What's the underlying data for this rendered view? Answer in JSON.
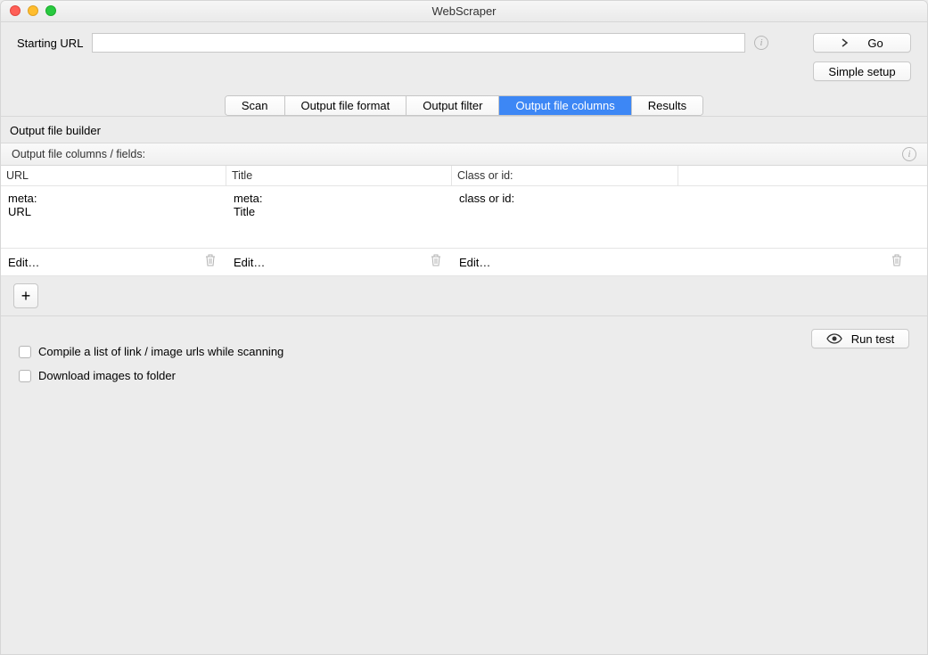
{
  "window": {
    "title": "WebScraper"
  },
  "url_bar": {
    "label": "Starting URL",
    "value": "",
    "go_label": "Go",
    "simple_setup_label": "Simple setup"
  },
  "tabs": {
    "scan": "Scan",
    "format": "Output file format",
    "filter": "Output filter",
    "columns": "Output file columns",
    "results": "Results"
  },
  "builder": {
    "heading": "Output file builder",
    "subheading": "Output file columns / fields:",
    "columns": {
      "url_hdr": "URL",
      "title_hdr": "Title",
      "class_hdr": "Class or id:"
    },
    "rows": {
      "url": {
        "line1": "meta:",
        "line2": "URL"
      },
      "title": {
        "line1": "meta:",
        "line2": "Title"
      },
      "class": {
        "line1": "class or id:",
        "line2": ""
      }
    },
    "edit_label": "Edit…",
    "add_label": "+",
    "run_test_label": "Run test"
  },
  "options": {
    "compile": "Compile a list of link / image urls while scanning",
    "download": "Download images to folder",
    "compile_checked": false,
    "download_checked": false
  }
}
